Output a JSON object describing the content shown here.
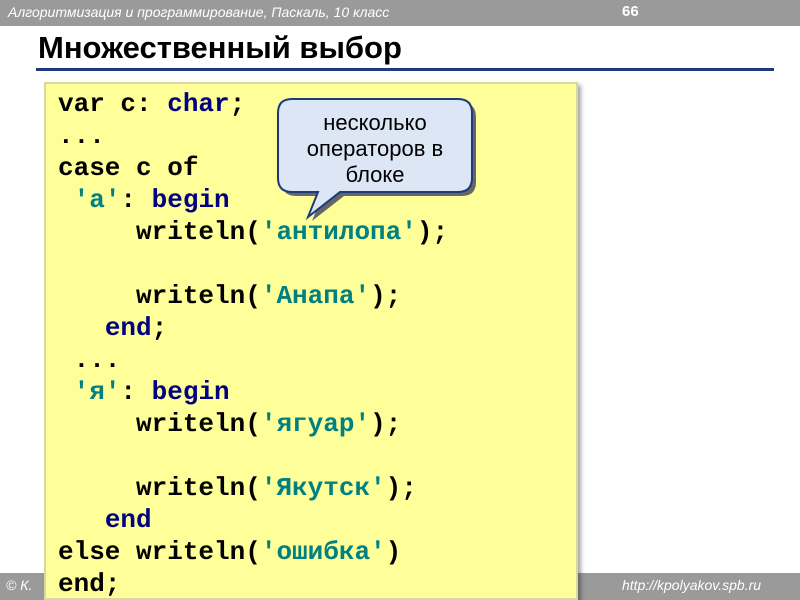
{
  "header": {
    "course_title": "Алгоритмизация и программирование, Паскаль, 10 класс",
    "page_number": "66"
  },
  "slide": {
    "title": "Множественный выбор"
  },
  "code": {
    "lines": [
      [
        {
          "t": "var c: ",
          "s": "plain"
        },
        {
          "t": "char",
          "s": "kw"
        },
        {
          "t": ";",
          "s": "plain"
        }
      ],
      [
        {
          "t": "...",
          "s": "plain"
        }
      ],
      [
        {
          "t": "case c of",
          "s": "plain"
        }
      ],
      [
        {
          "t": " ",
          "s": "plain"
        },
        {
          "t": "'а'",
          "s": "str"
        },
        {
          "t": ": ",
          "s": "plain"
        },
        {
          "t": "begin",
          "s": "kw"
        }
      ],
      [
        {
          "t": "     writeln(",
          "s": "plain"
        },
        {
          "t": "'антилопа'",
          "s": "str"
        },
        {
          "t": ");",
          "s": "plain"
        }
      ],
      [],
      [
        {
          "t": "     writeln(",
          "s": "plain"
        },
        {
          "t": "'Анапа'",
          "s": "str"
        },
        {
          "t": ");",
          "s": "plain"
        }
      ],
      [
        {
          "t": "   ",
          "s": "plain"
        },
        {
          "t": "end",
          "s": "kw"
        },
        {
          "t": ";",
          "s": "plain"
        }
      ],
      [
        {
          "t": " ...",
          "s": "plain"
        }
      ],
      [
        {
          "t": " ",
          "s": "plain"
        },
        {
          "t": "'я'",
          "s": "str"
        },
        {
          "t": ": ",
          "s": "plain"
        },
        {
          "t": "begin",
          "s": "kw"
        }
      ],
      [
        {
          "t": "     writeln(",
          "s": "plain"
        },
        {
          "t": "'ягуар'",
          "s": "str"
        },
        {
          "t": ");",
          "s": "plain"
        }
      ],
      [],
      [
        {
          "t": "     writeln(",
          "s": "plain"
        },
        {
          "t": "'Якутск'",
          "s": "str"
        },
        {
          "t": ");",
          "s": "plain"
        }
      ],
      [
        {
          "t": "   ",
          "s": "plain"
        },
        {
          "t": "end",
          "s": "kw"
        }
      ],
      [
        {
          "t": "else writeln(",
          "s": "plain"
        },
        {
          "t": "'ошибка'",
          "s": "str"
        },
        {
          "t": ")",
          "s": "plain"
        }
      ],
      [
        {
          "t": "end;",
          "s": "plain"
        }
      ]
    ]
  },
  "callout": {
    "line1": "несколько",
    "line2": "операторов в",
    "line3": "блоке"
  },
  "footer": {
    "left_text": "© К.",
    "right_text": "http://kpolyakov.spb.ru"
  },
  "colors": {
    "code_background": "#ffff99",
    "keyword": "#000080",
    "string_literal": "#008080",
    "title_rule": "#1f3a7a",
    "bar_gray": "#9a9a9a"
  }
}
